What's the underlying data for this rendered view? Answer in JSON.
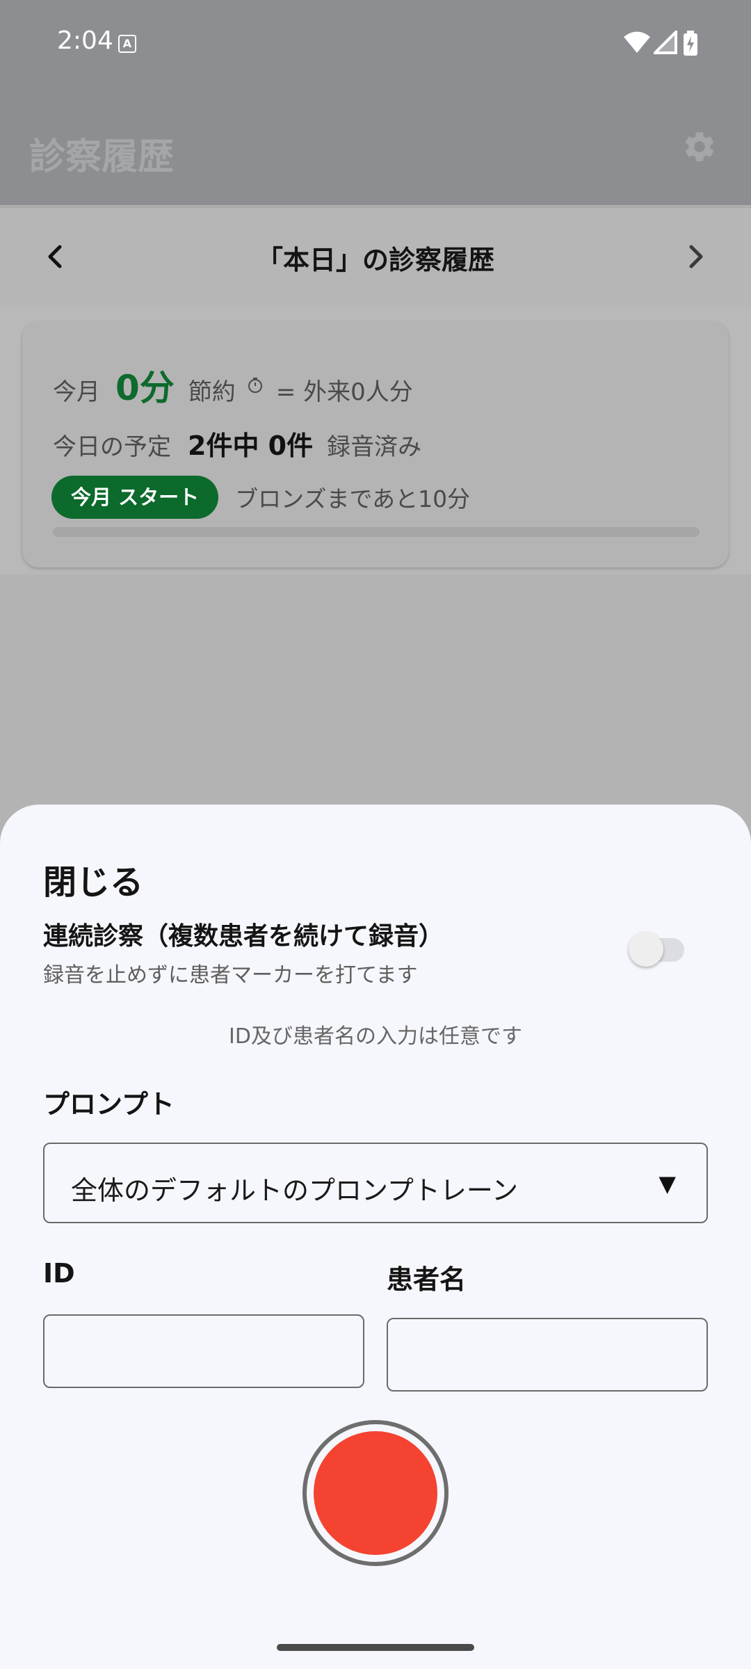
{
  "status_bar": {
    "time": "2:04",
    "notification_icon": "a-icon"
  },
  "app_bar": {
    "title": "診察履歴",
    "settings_icon": "gear-icon"
  },
  "nav": {
    "title": "「本日」の診察履歴",
    "prev_icon": "chevron-left-icon",
    "next_icon": "chevron-right-icon"
  },
  "summary": {
    "month_label": "今月",
    "minutes_saved": "0分",
    "saving_label": "節約",
    "equivalent": "= 外来0人分",
    "today_label": "今日の予定",
    "today_count": "2件中 0件",
    "recorded_label": "録音済み",
    "start_badge": "今月 スタート",
    "rank_text": "ブロンズまであと10分",
    "progress_fraction": 0,
    "accent_color": "#0e6a2d"
  },
  "sheet": {
    "close_title": "閉じる",
    "continuous_title": "連続診察（複数患者を続けて録音）",
    "continuous_subtitle": "録音を止めずに患者マーカーを打てます",
    "continuous_enabled": false,
    "optional_note": "ID及び患者名の入力は任意です",
    "prompt_label": "プロンプト",
    "prompt_value": "全体のデフォルトのプロンプトレーン",
    "prompt_arrow": "▼",
    "id_label": "ID",
    "id_value": "",
    "name_label": "患者名",
    "name_value": "",
    "record_color": "#f44331"
  }
}
